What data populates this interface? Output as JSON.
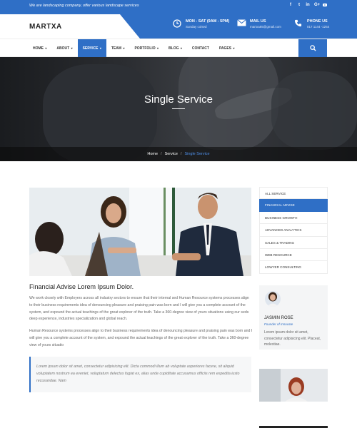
{
  "topbar": {
    "tagline": "We are landscaping company, offer various landscape services",
    "social": [
      "f",
      "t",
      "in",
      "G+",
      "yt"
    ]
  },
  "header": {
    "logo": "MARTXA",
    "info": [
      {
        "icon": "clock-icon",
        "title": "MON - SAT (9AM - 5PM)",
        "sub": "Sunday colsed"
      },
      {
        "icon": "mail-icon",
        "title": "MAIL US",
        "sub": "martxa85@gmail.com"
      },
      {
        "icon": "phone-icon",
        "title": "PHONE US",
        "sub": "017 1144 -1254"
      }
    ]
  },
  "nav": {
    "items": [
      "HOME",
      "ABOUT",
      "SERVICE",
      "TEAM",
      "PORTFOLIO",
      "BLOG",
      "CONTACT",
      "PAGES"
    ],
    "active": "SERVICE"
  },
  "hero": {
    "title": "Single Service",
    "breadcrumb": [
      "Home",
      "Service",
      "Single Service"
    ]
  },
  "main": {
    "title": "Financial Advise Lorem Ipsum Dolor.",
    "para1": "We work closely with Employers across all industry sectors to ensure that their internal sed Human Resource systems processes align to their business requirements idea of denouncing pleasure and praising pain was born and I will give you a complete account of the system, and expound the actual teachings of the great explorer of the truth. Take a 360-degree view of yours situations using our seds deep experience, industries specialization and global reach.",
    "para2": "Human Resource systems processes align to their business requirements idea of denouncing pleasure and praising pain was born and I will give you a complete account of the system, and expound the actual teachings of the great explorer of the truth. Take a 360-degree view of yours situatio",
    "quote": "Lorem ipsum dolor sit amet, consectetur adipisicing elit. Dicta commodi illum ab voluptate asperiores facere, sit aliquid voluptatem nostrum ea eveniet, voluptatum delectus fugiat ex, alias unde cupiditate accusamus officiis rem expedita iusto recusandae. Nam"
  },
  "sidebar": {
    "items": [
      "ALL SERVICE",
      "FINANCIAL ADVISE",
      "BUSINESS GROWTH",
      "ADVANCED ANALYTICS",
      "SALES & TRADING",
      "WEB RESOURCE",
      "LOWYER CONSULTING"
    ],
    "active": "FINANCIAL ADVISE"
  },
  "profile": {
    "name": "JASMIN ROSE",
    "role": "Founder of Innovate",
    "desc": "Lorem ipsum dolor sit amet, consectetur adipisicing elit. Placeat, molestiae."
  },
  "colors": {
    "accent": "#2f6fc6",
    "hero_bg": "#1d1f22",
    "text": "#555555"
  }
}
